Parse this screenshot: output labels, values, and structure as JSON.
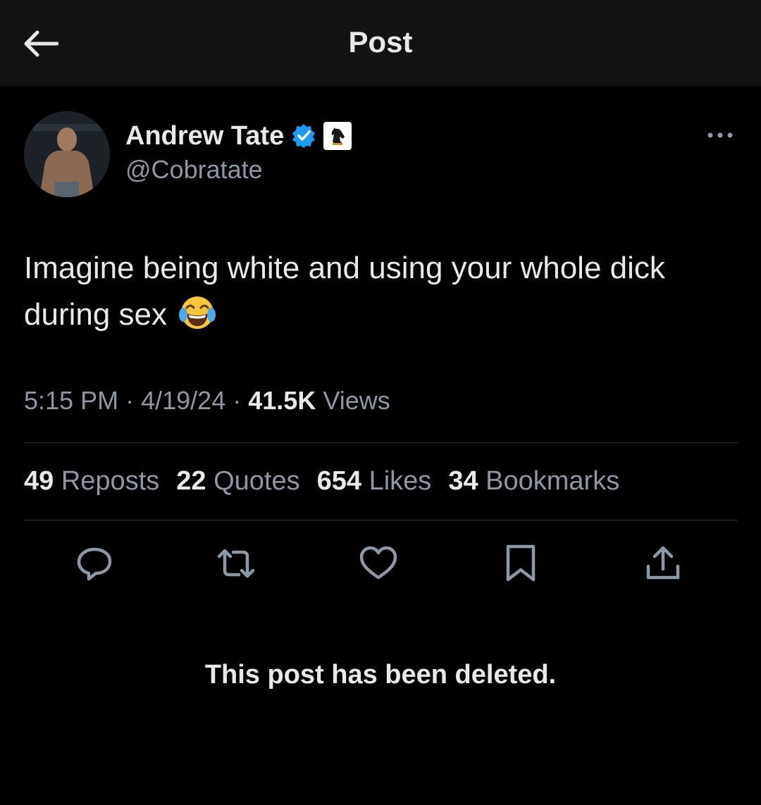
{
  "header": {
    "title": "Post",
    "back_icon": "arrow-left-icon"
  },
  "author": {
    "name": "Andrew Tate",
    "handle": "@Cobratate",
    "verified_color": "#1d9bf0",
    "affiliation_icon": "chess-knight-icon"
  },
  "post": {
    "text_line1": "Imagine being white and using your whole dick",
    "text_line2": "during sex",
    "emoji": "face-with-tears-of-joy",
    "time": "5:15 PM",
    "date": "4/19/24",
    "views_count": "41.5K",
    "views_label": "Views",
    "sep": "·"
  },
  "stats": [
    {
      "count": "49",
      "label": "Reposts"
    },
    {
      "count": "22",
      "label": "Quotes"
    },
    {
      "count": "654",
      "label": "Likes"
    },
    {
      "count": "34",
      "label": "Bookmarks"
    }
  ],
  "actions": [
    "reply-icon",
    "repost-icon",
    "like-icon",
    "bookmark-icon",
    "share-icon"
  ],
  "deleted_notice": "This post has been deleted.",
  "colors": {
    "background": "#000000",
    "header": "#121212",
    "text": "#e7e9ea",
    "muted": "#8b98a5",
    "divider": "#2f3336"
  }
}
